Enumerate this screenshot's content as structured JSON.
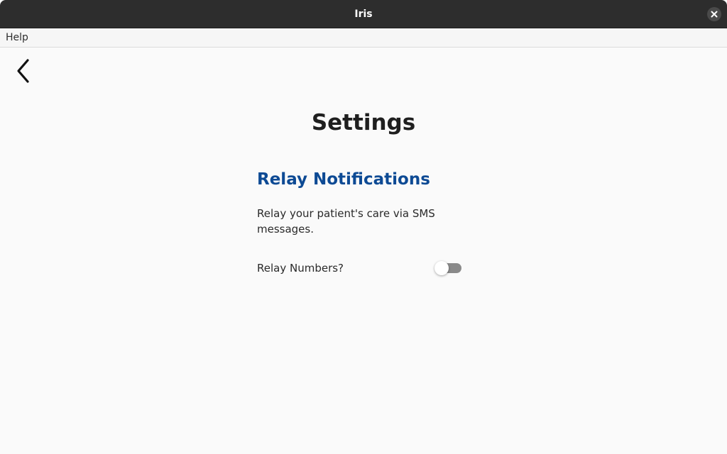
{
  "window": {
    "title": "Iris",
    "close_icon": "close-icon"
  },
  "menubar": {
    "items": [
      {
        "label": "Help"
      }
    ]
  },
  "toolbar": {
    "back_icon": "chevron-left-icon"
  },
  "page": {
    "title": "Settings"
  },
  "relay_section": {
    "heading": "Relay Notifications",
    "description": "Relay your patient's care via SMS messages.",
    "toggle": {
      "label": "Relay Numbers?",
      "checked": false
    }
  },
  "colors": {
    "titlebar": "#2d2d2d",
    "background": "#fafafa",
    "heading_accent": "#0d4a94",
    "toggle_off_track": "#8a8a8a"
  }
}
